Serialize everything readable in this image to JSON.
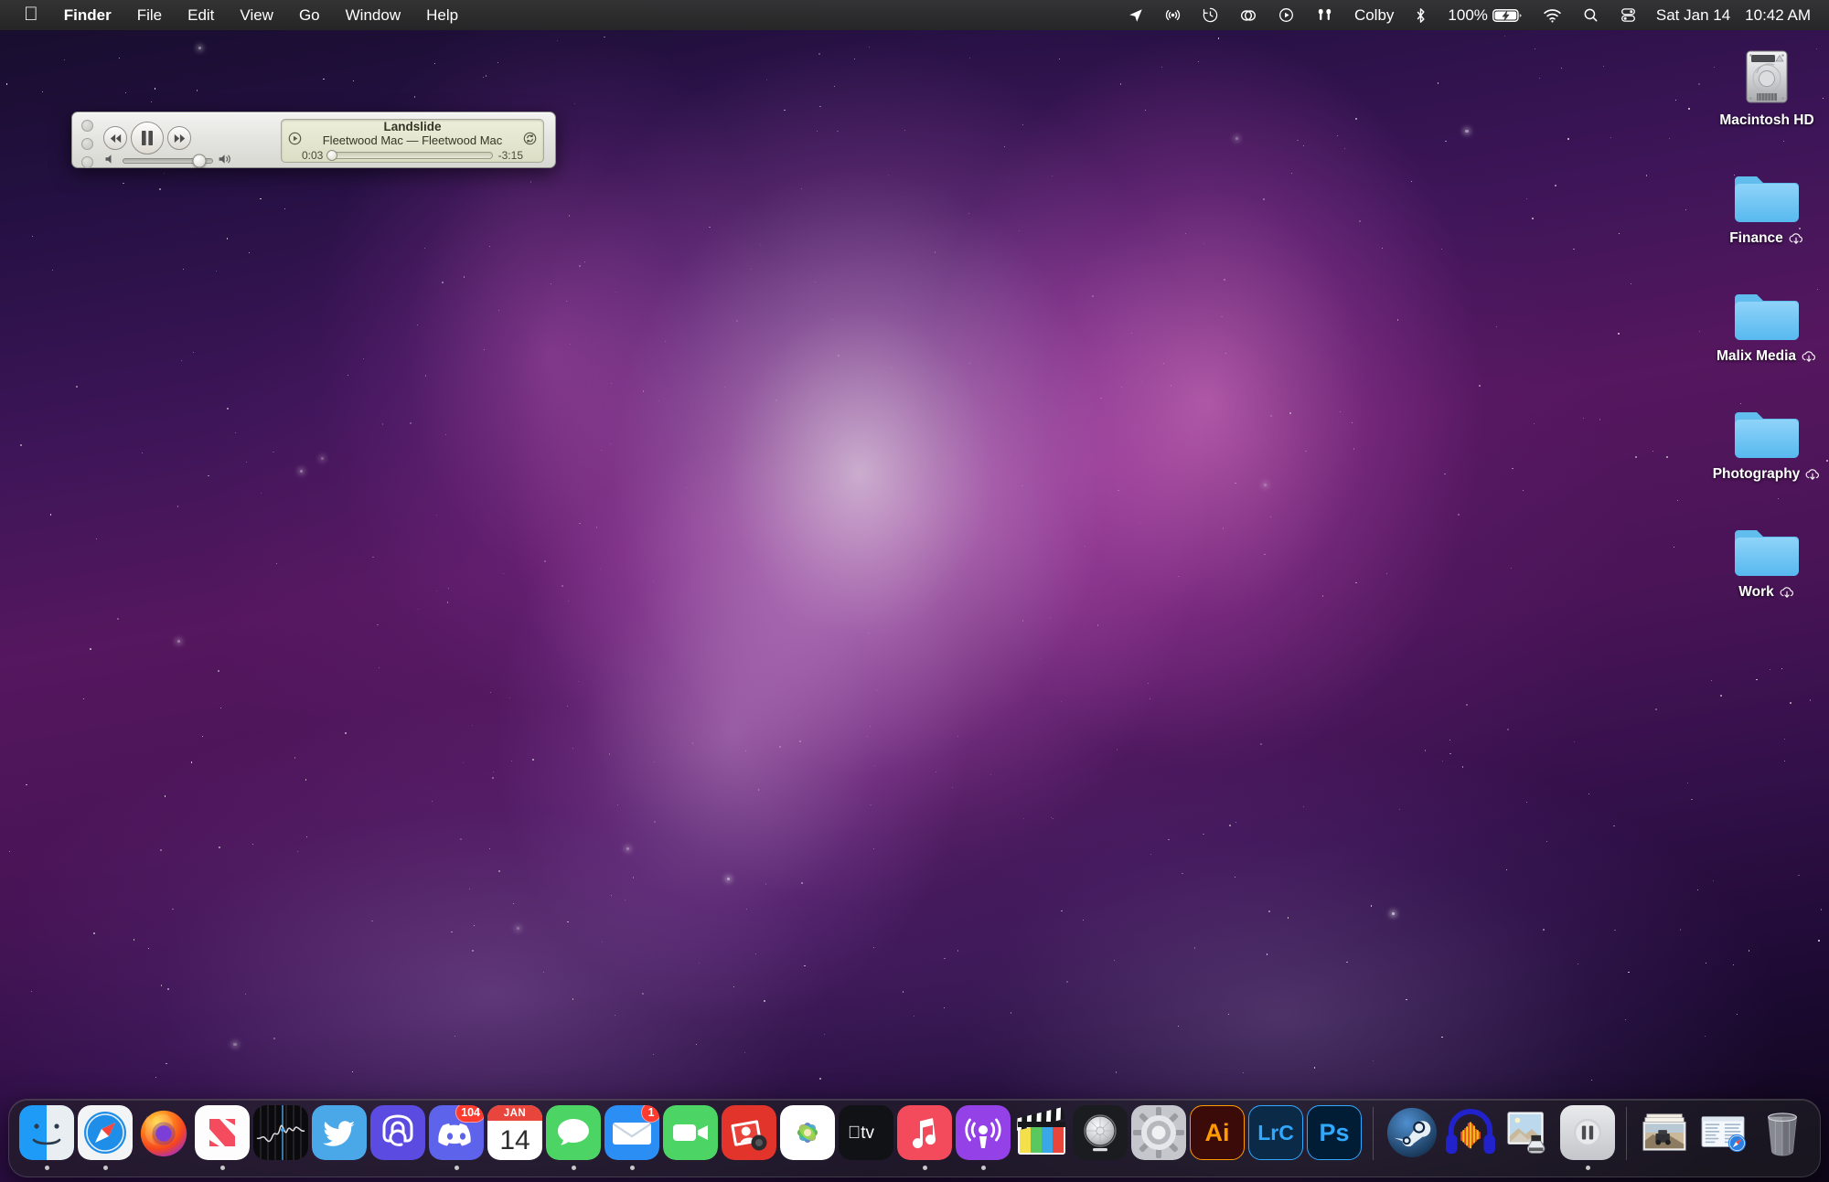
{
  "menubar": {
    "apple_icon": "apple-logo-icon",
    "items": [
      {
        "label": "Finder",
        "bold": true
      },
      {
        "label": "File",
        "bold": false
      },
      {
        "label": "Edit",
        "bold": false
      },
      {
        "label": "View",
        "bold": false
      },
      {
        "label": "Go",
        "bold": false
      },
      {
        "label": "Window",
        "bold": false
      },
      {
        "label": "Help",
        "bold": false
      }
    ],
    "status_icons": [
      "location-arrow-icon",
      "airplay-audio-icon",
      "time-machine-icon",
      "creative-cloud-icon",
      "now-playing-icon",
      "airpods-icon"
    ],
    "user_name": "Colby",
    "bluetooth_icon": "bluetooth-icon",
    "battery_percent": "100%",
    "battery_icon": "battery-charging-icon",
    "wifi_icon": "wifi-icon",
    "search_icon": "search-icon",
    "control_center_icon": "control-center-icon",
    "date": "Sat Jan 14",
    "time": "10:42 AM"
  },
  "desktop_icons": [
    {
      "name": "Macintosh HD",
      "type": "hard-drive",
      "cloud": false
    },
    {
      "name": "Finance",
      "type": "folder",
      "cloud": true
    },
    {
      "name": "Malix Media",
      "type": "folder",
      "cloud": true
    },
    {
      "name": "Photography",
      "type": "folder",
      "cloud": true
    },
    {
      "name": "Work",
      "type": "folder",
      "cloud": true
    }
  ],
  "miniplayer": {
    "window_name": "iTunes Mini Player",
    "traffic_lights": [
      "close-button",
      "minimize-button",
      "zoom-button"
    ],
    "rewind_icon": "rewind-icon",
    "playpause_icon": "pause-icon",
    "forward_icon": "fast-forward-icon",
    "volume_low_icon": "volume-low-icon",
    "volume_high_icon": "volume-high-icon",
    "volume_level": 86,
    "airplay_icon": "airplay-icon",
    "shuffle_repeat_icon": "repeat-icon",
    "track_title": "Landslide",
    "track_artist_album": "Fleetwood Mac — Fleetwood Mac",
    "elapsed": "0:03",
    "remaining": "-3:15",
    "progress_percent": 1.5
  },
  "dock": {
    "items": [
      {
        "name": "Finder",
        "icon": "finder-icon",
        "running": true,
        "badge": null
      },
      {
        "name": "Safari",
        "icon": "safari-icon",
        "running": true,
        "badge": null
      },
      {
        "name": "Firefox",
        "icon": "firefox-icon",
        "running": false,
        "badge": null
      },
      {
        "name": "News",
        "icon": "news-icon",
        "running": true,
        "badge": null
      },
      {
        "name": "Stocks",
        "icon": "stocks-icon",
        "running": false,
        "badge": null
      },
      {
        "name": "Twitter",
        "icon": "twitter-icon",
        "running": false,
        "badge": null
      },
      {
        "name": "Mastodon",
        "icon": "mastodon-icon",
        "running": false,
        "badge": null
      },
      {
        "name": "Discord",
        "icon": "discord-icon",
        "running": true,
        "badge": "104"
      },
      {
        "name": "Calendar",
        "icon": "calendar-icon",
        "running": false,
        "badge": null,
        "month": "JAN",
        "day": "14"
      },
      {
        "name": "Messages",
        "icon": "messages-icon",
        "running": true,
        "badge": null
      },
      {
        "name": "Mail",
        "icon": "mail-icon",
        "running": true,
        "badge": "1"
      },
      {
        "name": "FaceTime",
        "icon": "facetime-icon",
        "running": false,
        "badge": null
      },
      {
        "name": "Photo Booth",
        "icon": "photo-booth-icon",
        "running": false,
        "badge": null
      },
      {
        "name": "Photos",
        "icon": "photos-icon",
        "running": false,
        "badge": null
      },
      {
        "name": "Apple TV",
        "icon": "apple-tv-icon",
        "running": false,
        "badge": null
      },
      {
        "name": "Music",
        "icon": "music-icon",
        "running": true,
        "badge": null
      },
      {
        "name": "Podcasts",
        "icon": "podcasts-icon",
        "running": true,
        "badge": null
      },
      {
        "name": "Final Cut Pro",
        "icon": "final-cut-pro-icon",
        "running": false,
        "badge": null
      },
      {
        "name": "Logic Pro",
        "icon": "logic-pro-icon",
        "running": false,
        "badge": null
      },
      {
        "name": "System Settings",
        "icon": "system-settings-icon",
        "running": false,
        "badge": null
      },
      {
        "name": "Adobe Illustrator",
        "icon": "illustrator-icon",
        "running": false,
        "badge": null,
        "label": "Ai"
      },
      {
        "name": "Adobe Lightroom Classic",
        "icon": "lightroom-classic-icon",
        "running": false,
        "badge": null,
        "label": "LrC"
      },
      {
        "name": "Adobe Photoshop",
        "icon": "photoshop-icon",
        "running": false,
        "badge": null,
        "label": "Ps"
      },
      {
        "name": "Steam",
        "icon": "steam-icon",
        "running": false,
        "badge": null
      },
      {
        "name": "Audacity",
        "icon": "audacity-icon",
        "running": false,
        "badge": null
      },
      {
        "name": "Preview",
        "icon": "preview-icon",
        "running": false,
        "badge": null
      },
      {
        "name": "Pause",
        "icon": "pause-app-icon",
        "running": true,
        "badge": null
      },
      {
        "name": "Pictures Stack",
        "icon": "pictures-stack-icon",
        "running": false,
        "badge": null
      },
      {
        "name": "Downloads Stack",
        "icon": "downloads-stack-icon",
        "running": false,
        "badge": null
      },
      {
        "name": "Trash",
        "icon": "trash-icon",
        "running": false,
        "badge": null
      }
    ]
  }
}
